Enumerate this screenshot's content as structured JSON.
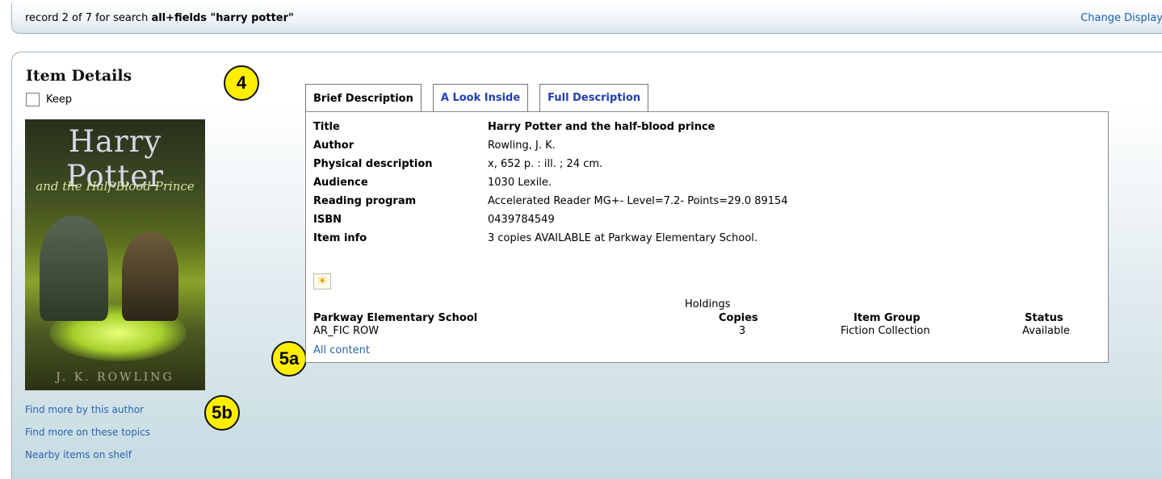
{
  "search_bar": {
    "status_prefix": "record 2 of 7 for search ",
    "status_query": "all+fields \"harry potter\"",
    "change_display": "Change Display"
  },
  "item": {
    "title": "Item Details",
    "keep_label": "Keep",
    "cover": {
      "title_text": "Harry Potter",
      "subtitle_text": "and the Half-Blood Prince",
      "author_text": "J. K. ROWLING"
    }
  },
  "left_links": [
    "Find more by this author",
    "Find more on these topics",
    "Nearby items on shelf"
  ],
  "callouts": {
    "c4": "4",
    "c5a": "5a",
    "c5b": "5b"
  },
  "tabs": [
    {
      "label": "Brief Description",
      "active": true
    },
    {
      "label": "A Look Inside",
      "active": false
    },
    {
      "label": "Full Description",
      "active": false
    }
  ],
  "brief": {
    "rows": [
      {
        "label": "Title",
        "value": "Harry Potter and the half-blood prince"
      },
      {
        "label": "Author",
        "value": "Rowling, J. K."
      },
      {
        "label": "Physical description",
        "value": "x, 652 p. : ill. ; 24 cm."
      },
      {
        "label": "Audience",
        "value": "1030 Lexile."
      },
      {
        "label": "Reading program",
        "value": "Accelerated Reader MG+- Level=7.2- Points=29.0 89154"
      },
      {
        "label": "ISBN",
        "value": "0439784549"
      },
      {
        "label": "Item info",
        "value": "3 copies AVAILABLE at Parkway Elementary School."
      }
    ],
    "icon": "sun-icon"
  },
  "holdings": {
    "title": "Holdings",
    "headers": [
      "Parkway Elementary School",
      "Copies",
      "Item Group",
      "Status"
    ],
    "row": [
      "AR_FIC ROW",
      "3",
      "Fiction Collection",
      "Available"
    ],
    "all_content": "All content"
  }
}
